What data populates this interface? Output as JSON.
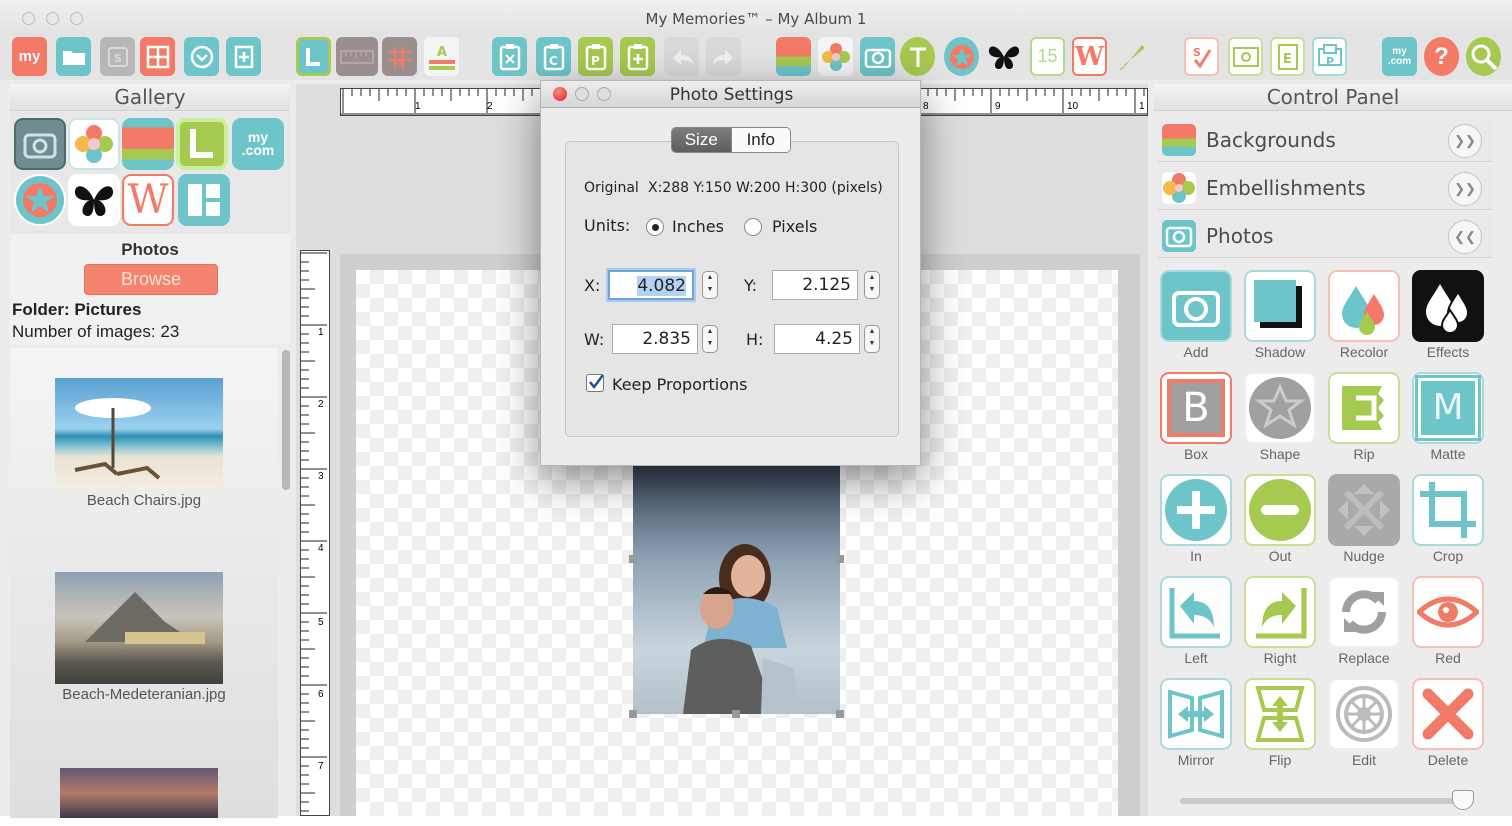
{
  "window": {
    "title": "My Memories™ – My Album 1"
  },
  "toolbar": {
    "my_label": "my",
    "mycom_label": "my .com",
    "icons": [
      "my-logo-icon",
      "folder-icon",
      "save-icon",
      "layout-icon",
      "download-icon",
      "add-page-icon",
      "layout-l-icon",
      "ruler-icon",
      "grid-icon",
      "text-align-icon",
      "clipboard-cut-icon",
      "clipboard-copy-icon",
      "clipboard-paste-icon",
      "clipboard-add-icon",
      "undo-icon",
      "redo-icon",
      "backgrounds-icon",
      "embellishments-icon",
      "camera-icon",
      "text-t-icon",
      "star-icon",
      "butterfly-icon",
      "calendar-icon",
      "wordart-icon",
      "brush-icon",
      "spellcheck-icon",
      "preview-icon",
      "export-e-icon",
      "print-p-icon",
      "mycom-icon",
      "help-icon",
      "zoom-icon"
    ],
    "calendar_day": "15"
  },
  "gallery": {
    "title": "Gallery",
    "icons": [
      "camera-icon",
      "flower-icon",
      "stripes-icon",
      "layout-l-icon",
      "mycom-icon",
      "star-icon",
      "butterfly-icon",
      "wordart-icon",
      "layout-grid-icon"
    ],
    "mycom_label": "my .com",
    "photos_heading": "Photos",
    "browse_label": "Browse",
    "folder_label": "Folder:",
    "folder_value": "Pictures",
    "count_label": "Number of images:",
    "count_value": "23",
    "thumbnails": [
      {
        "caption": "Beach Chairs.jpg"
      },
      {
        "caption": "Beach-Medeteranian.jpg"
      },
      {
        "caption": ""
      }
    ]
  },
  "ruler": {
    "h_numbers": [
      "1",
      "2",
      "8",
      "9",
      "10",
      "1"
    ],
    "v_numbers": [
      "1",
      "2",
      "3",
      "4",
      "5",
      "6",
      "7"
    ]
  },
  "dialog": {
    "title": "Photo Settings",
    "tabs": [
      "Size",
      "Info"
    ],
    "active_tab": "Size",
    "original_label": "Original",
    "original_value": "X:288 Y:150  W:200 H:300 (pixels)",
    "units_label": "Units:",
    "unit_inches": "Inches",
    "unit_pixels": "Pixels",
    "selected_unit": "Inches",
    "x_label": "X:",
    "x_value": "4.082",
    "y_label": "Y:",
    "y_value": "2.125",
    "w_label": "W:",
    "w_value": "2.835",
    "h_label": "H:",
    "h_value": "4.25",
    "keep_label": "Keep Proportions",
    "keep_checked": true
  },
  "control_panel": {
    "title": "Control Panel",
    "sections": [
      {
        "label": "Backgrounds",
        "state": "collapsed"
      },
      {
        "label": "Embellishments",
        "state": "collapsed"
      },
      {
        "label": "Photos",
        "state": "expanded"
      }
    ],
    "tools": [
      {
        "label": "Add",
        "icon": "camera-icon"
      },
      {
        "label": "Shadow",
        "icon": "shadow-icon"
      },
      {
        "label": "Recolor",
        "icon": "recolor-drops-icon"
      },
      {
        "label": "Effects",
        "icon": "effects-drops-icon"
      },
      {
        "label": "Box",
        "icon": "box-b-icon",
        "glyph": "B"
      },
      {
        "label": "Shape",
        "icon": "shape-star-icon"
      },
      {
        "label": "Rip",
        "icon": "rip-icon"
      },
      {
        "label": "Matte",
        "icon": "matte-m-icon",
        "glyph": "M"
      },
      {
        "label": "In",
        "icon": "zoom-in-plus-icon"
      },
      {
        "label": "Out",
        "icon": "zoom-out-minus-icon"
      },
      {
        "label": "Nudge",
        "icon": "nudge-arrows-icon"
      },
      {
        "label": "Crop",
        "icon": "crop-icon"
      },
      {
        "label": "Left",
        "icon": "rotate-left-icon"
      },
      {
        "label": "Right",
        "icon": "rotate-right-icon"
      },
      {
        "label": "Replace",
        "icon": "replace-cycle-icon"
      },
      {
        "label": "Red",
        "icon": "red-eye-icon"
      },
      {
        "label": "Mirror",
        "icon": "mirror-icon"
      },
      {
        "label": "Flip",
        "icon": "flip-icon"
      },
      {
        "label": "Edit",
        "icon": "edit-gear-icon"
      },
      {
        "label": "Delete",
        "icon": "delete-x-icon"
      }
    ]
  },
  "colors": {
    "coral": "#f27a66",
    "teal": "#6ec5c9",
    "green": "#a6c950",
    "dark_teal": "#3aa7ad",
    "gray": "#9a9a9a"
  }
}
